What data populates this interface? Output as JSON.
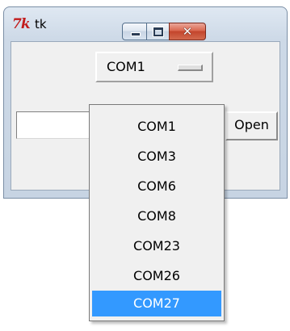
{
  "window": {
    "title": "tk",
    "icon": "tk-feather-icon",
    "icon_text": "7k",
    "caption_buttons": {
      "minimize": "minimize",
      "maximize": "maximize",
      "close_glyph": "✕"
    }
  },
  "port_select": {
    "selected_value": "COM1"
  },
  "entry": {
    "value": ""
  },
  "open_button": {
    "label": "Open"
  },
  "dropdown": {
    "options": [
      "COM1",
      "COM3",
      "COM6",
      "COM8",
      "COM23",
      "COM26",
      "COM27"
    ],
    "highlighted_index": 6
  },
  "colors": {
    "highlight": "#3399ff",
    "close_button": "#c3452c",
    "tk_icon": "#c21c1c",
    "client_background": "#f0f0f0"
  }
}
